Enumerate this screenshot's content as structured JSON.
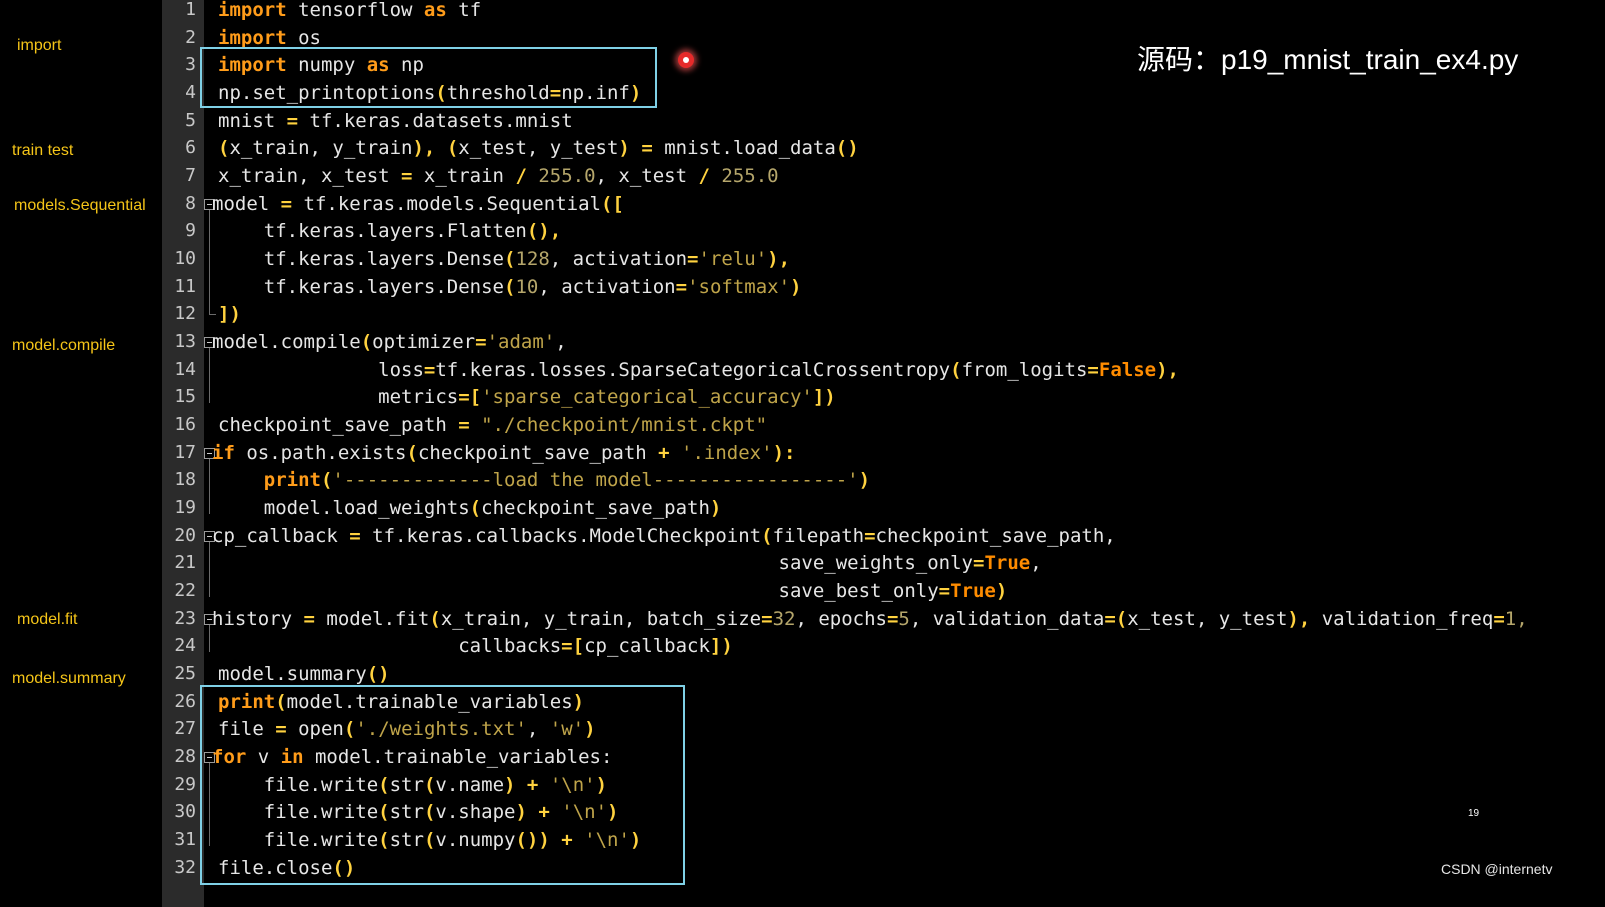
{
  "side_labels": [
    "import",
    "train  test",
    "models.Sequential",
    "model.compile",
    "model.fit",
    "model.summary"
  ],
  "line_numbers": [
    "1",
    "2",
    "3",
    "4",
    "5",
    "6",
    "7",
    "8",
    "9",
    "10",
    "11",
    "12",
    "13",
    "14",
    "15",
    "16",
    "17",
    "18",
    "19",
    "20",
    "21",
    "22",
    "23",
    "24",
    "25",
    "26",
    "27",
    "28",
    "29",
    "30",
    "31",
    "32"
  ],
  "code": {
    "l1": {
      "a": "import",
      "b": " tensorflow ",
      "c": "as",
      "d": " tf"
    },
    "l2": {
      "a": "import",
      "b": " os"
    },
    "l3": {
      "a": "import",
      "b": " numpy ",
      "c": "as",
      "d": " np"
    },
    "l4": {
      "a": "np.set_printoptions",
      "b": "(",
      "c": "threshold",
      "d": "=",
      "e": "np.inf",
      "f": ")"
    },
    "l5": {
      "a": "mnist ",
      "b": "=",
      "c": " tf.keras.datasets.mnist"
    },
    "l6": {
      "a": "(",
      "b": "x_train, y_train",
      "c": "),",
      "d": " (",
      "e": "x_test, y_test",
      "f": ")",
      "g": " = ",
      "h": "mnist.load_data",
      "i": "()"
    },
    "l7": {
      "a": "x_train, x_test ",
      "b": "=",
      "c": " x_train ",
      "d": "/",
      "e": " 255.0",
      "f": ", x_test ",
      "g": "/",
      "h": " 255.0"
    },
    "l8": {
      "a": "model ",
      "b": "=",
      "c": " tf.keras.models.Sequential",
      "d": "(["
    },
    "l9": {
      "a": "    tf.keras.layers.Flatten",
      "b": "(),"
    },
    "l10": {
      "a": "    tf.keras.layers.Dense",
      "b": "(",
      "c": "128",
      "d": ", activation",
      "e": "=",
      "f": "'relu'",
      "g": "),"
    },
    "l11": {
      "a": "    tf.keras.layers.Dense",
      "b": "(",
      "c": "10",
      "d": ", activation",
      "e": "=",
      "f": "'softmax'",
      "g": ")"
    },
    "l12": {
      "a": "])"
    },
    "l13": {
      "a": "model.compile",
      "b": "(",
      "c": "optimizer",
      "d": "=",
      "e": "'adam'",
      "f": ","
    },
    "l14": {
      "a": "              loss",
      "b": "=",
      "c": "tf.keras.losses.SparseCategoricalCrossentropy",
      "d": "(",
      "e": "from_logits",
      "f": "=",
      "g": "False",
      "h": "),"
    },
    "l15": {
      "a": "              metrics",
      "b": "=[",
      "c": "'sparse_categorical_accuracy'",
      "d": "])"
    },
    "l16": {
      "a": "checkpoint_save_path ",
      "b": "=",
      "c": " \"./checkpoint/mnist.ckpt\""
    },
    "l17": {
      "a": "if",
      "b": " os.path.exists",
      "c": "(",
      "d": "checkpoint_save_path ",
      "e": "+",
      "f": " '.index'",
      "g": "):"
    },
    "l18": {
      "a": "    ",
      "b": "print",
      "c": "(",
      "d": "'-------------load the model-----------------'",
      "e": ")"
    },
    "l19": {
      "a": "    model.load_weights",
      "b": "(",
      "c": "checkpoint_save_path",
      "d": ")"
    },
    "l20": {
      "a": "cp_callback ",
      "b": "=",
      "c": " tf.keras.callbacks.ModelCheckpoint",
      "d": "(",
      "e": "filepath",
      "f": "=",
      "g": "checkpoint_save_path,"
    },
    "l21": {
      "a": "                                                 save_weights_only",
      "b": "=",
      "c": "True",
      "d": ","
    },
    "l22": {
      "a": "                                                 save_best_only",
      "b": "=",
      "c": "True",
      "d": ")"
    },
    "l23": {
      "a": "history ",
      "b": "=",
      "c": " model.fit",
      "d": "(",
      "e": "x_train, y_train, batch_size",
      "f": "=",
      "g": "32",
      "h": ", epochs",
      "i": "=",
      "j": "5",
      "k": ", validation_data",
      "l": "=(",
      "m": "x_test, y_test",
      "n": "),",
      "o": " validation_freq",
      "p": "=",
      "q": "1,"
    },
    "l24": {
      "a": "                     callbacks",
      "b": "=[",
      "c": "cp_callback",
      "d": "])"
    },
    "l25": {
      "a": "model.summary",
      "b": "()"
    },
    "l26": {
      "a": "print",
      "b": "(",
      "c": "model.trainable_variables",
      "d": ")"
    },
    "l27": {
      "a": "file ",
      "b": "=",
      "c": " open",
      "d": "(",
      "e": "'./weights.txt'",
      "f": ", ",
      "g": "'w'",
      "h": ")"
    },
    "l28": {
      "a": "for",
      "b": " v ",
      "c": "in",
      "d": " model.trainable_variables:"
    },
    "l29": {
      "a": "    file.write",
      "b": "(",
      "c": "str",
      "d": "(",
      "e": "v.name",
      "f": ")",
      "g": " + ",
      "h": "'\\n'",
      "i": ")"
    },
    "l30": {
      "a": "    file.write",
      "b": "(",
      "c": "str",
      "d": "(",
      "e": "v.shape",
      "f": ")",
      "g": " + ",
      "h": "'\\n'",
      "i": ")"
    },
    "l31": {
      "a": "    file.write",
      "b": "(",
      "c": "str",
      "d": "(",
      "e": "v.numpy",
      "f": "())",
      "g": " + ",
      "h": "'\\n'",
      "i": ")"
    },
    "l32": {
      "a": "file.close",
      "b": "()"
    }
  },
  "source_title": "源码：p19_mnist_train_ex4.py",
  "page_number": "19",
  "watermark": "CSDN @internetv",
  "colors": {
    "keyword": "#ff9c1a",
    "operator": "#ffd23f",
    "string": "#bfa44a",
    "highlight_box": "#7fd0e6",
    "side_label": "#f5c518"
  }
}
